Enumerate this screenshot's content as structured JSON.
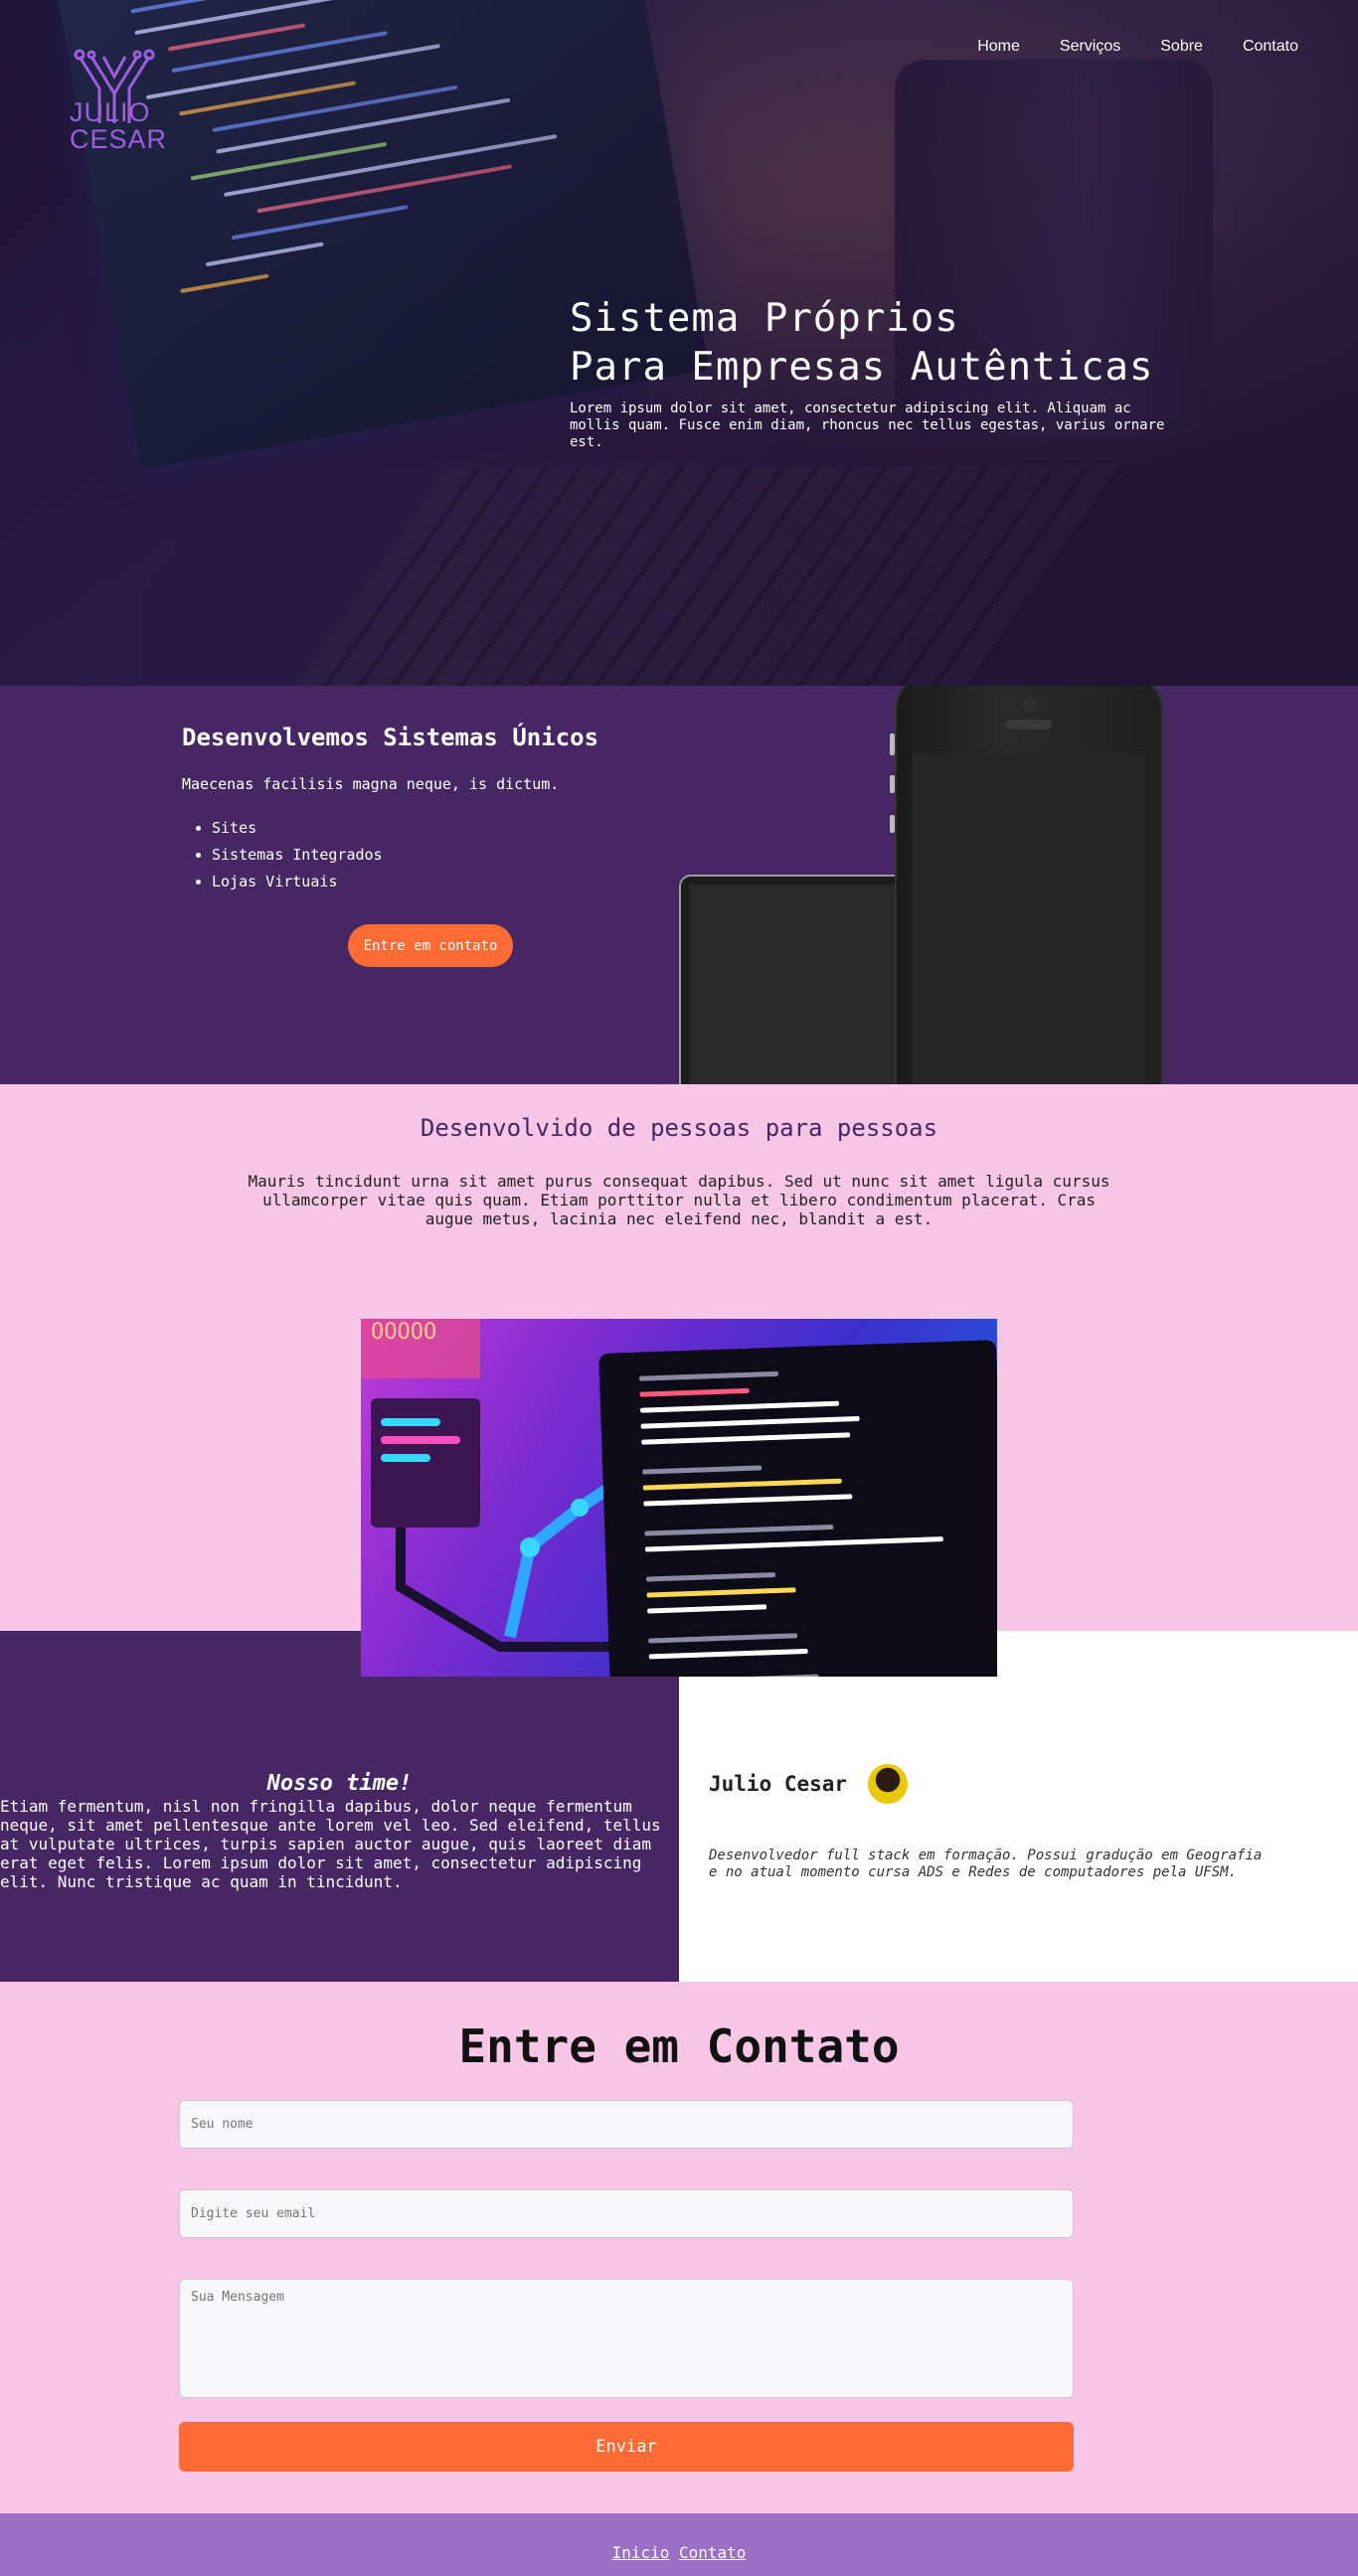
{
  "logo": {
    "line1": "JULIO",
    "line2": "CESAR"
  },
  "nav": {
    "items": [
      "Home",
      "Serviços",
      "Sobre",
      "Contato"
    ]
  },
  "hero": {
    "title_line1": "Sistema Próprios",
    "title_line2": "Para Empresas Autênticas",
    "text": "Lorem ipsum dolor sit amet, consectetur adipiscing elit. Aliquam ac mollis quam. Fusce enim diam, rhoncus nec tellus egestas, varius ornare est."
  },
  "services": {
    "title": "Desenvolvemos Sistemas Únicos",
    "lead": "Maecenas facilisis magna neque, is dictum.",
    "items": [
      "Sites",
      "Sistemas Integrados",
      "Lojas Virtuais"
    ],
    "button": "Entre em contato"
  },
  "about": {
    "title": "Desenvolvido de pessoas para pessoas",
    "text": "Mauris tincidunt urna sit amet purus consequat dapibus. Sed ut nunc sit amet ligula cursus ullamcorper vitae quis quam. Etiam porttitor nulla et libero condimentum placerat. Cras augue metus, lacinia nec eleifend nec, blandit a est."
  },
  "story": {
    "title": "Nosso time!",
    "text": "Etiam fermentum, nisl non fringilla dapibus, dolor neque fermentum neque, sit amet pellentesque ante lorem vel leo. Sed eleifend, tellus at vulputate ultrices, turpis sapien auctor augue, quis laoreet diam erat eget felis. Lorem ipsum dolor sit amet, consectetur adipiscing elit. Nunc tristique ac quam in tincidunt."
  },
  "author": {
    "name": "Julio Cesar",
    "bio": "Desenvolvedor full stack em formação. Possui gradução em Geografia e no atual momento cursa ADS e Redes de computadores pela UFSM."
  },
  "contact": {
    "title": "Entre em Contato",
    "name_placeholder": "Seu nome",
    "email_placeholder": "Digite seu email",
    "message_placeholder": "Sua Mensagem",
    "submit": "Enviar"
  },
  "footer": {
    "link1": "Inicio",
    "link2": "Contato"
  },
  "colors": {
    "purple": "#462764",
    "pink": "#f7c6e6",
    "orange": "#ff6b35",
    "footer": "#9b6fc6"
  }
}
